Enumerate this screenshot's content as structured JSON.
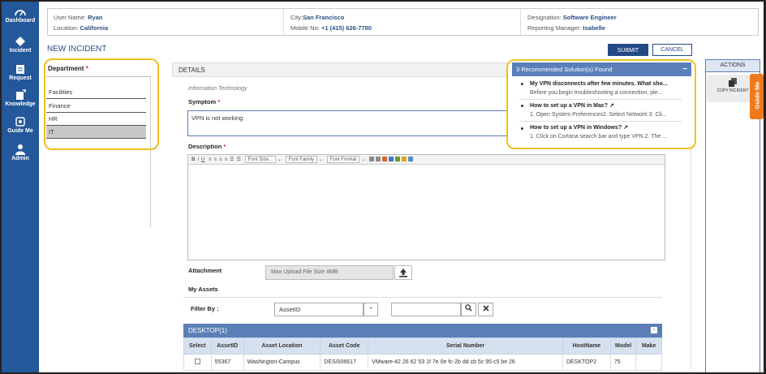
{
  "nav": [
    {
      "label": "Dashboard",
      "icon": "dashboard-icon"
    },
    {
      "label": "Incident",
      "icon": "diamond-icon"
    },
    {
      "label": "Request",
      "icon": "request-icon"
    },
    {
      "label": "Knowledge",
      "icon": "knowledge-icon"
    },
    {
      "label": "Guide Me",
      "icon": "guide-icon"
    },
    {
      "label": "Admin",
      "icon": "admin-icon"
    }
  ],
  "header": {
    "user_name_label": "User Name:",
    "user_name": "Ryan",
    "location_label": "Location:",
    "location": "California",
    "city_label": "City:",
    "city": "San Francisco",
    "mobile_label": "Mobile No:",
    "mobile": "+1 (415) 626-7780",
    "designation_label": "Designation:",
    "designation": "Software Engineer",
    "manager_label": "Reporting Manager:",
    "manager": "Isabelle"
  },
  "page_title": "NEW INCIDENT",
  "buttons": {
    "submit": "SUBMIT",
    "cancel": "CANCEL"
  },
  "department": {
    "label": "Department",
    "required": "*",
    "items": [
      "Facilities",
      "Finance",
      "HR",
      "IT"
    ],
    "selected": "IT"
  },
  "details": {
    "heading": "DETAILS",
    "category": "Information Technology",
    "symptom_label": "Symptom",
    "symptom_value": "VPN is not working",
    "description_label": "Description",
    "toolbar": {
      "font_size": "Font Size...",
      "font_family": "Font Family",
      "font_format": "Font Format"
    },
    "attachment_label": "Attachment",
    "upload_placeholder": "Max Upload File Size 4MB",
    "my_assets_label": "My Assets",
    "filter_label": "Filter By :",
    "filter_value": "AssetID",
    "filter_arrow": "*"
  },
  "desktop": {
    "title": "DESKTOP(1)",
    "columns": [
      "Select",
      "AssetID",
      "Asset Location",
      "Asset Code",
      "Serial Number",
      "HostName",
      "Model",
      "Make"
    ],
    "rows": [
      [
        "",
        "55367",
        "Washington-Campus",
        "DES/006617",
        "VMware-42 26 62 53 1f 7e 0e fc-2b dd cb 5c 95 c5 be 26",
        "DESKTOP2",
        "75",
        ""
      ]
    ]
  },
  "recommendations": {
    "heading": "3 Recommended Solution(s) Found",
    "items": [
      {
        "title": "My VPN disconnects after few minutes. What sho...",
        "desc": "Before you begin troubleshooting a connection, ple..."
      },
      {
        "title": "How to set up a VPN in Mac?",
        "desc": "1. Open System Preferences2. Select Network 3. Cli..."
      },
      {
        "title": "How to set up a VPN in Windows?",
        "desc": "1. Click on Cortana search bar and type VPN.2. The ..."
      }
    ]
  },
  "actions": {
    "heading": "ACTIONS",
    "copy_incident": "COPY INCIDENT"
  },
  "guide_tab": "Guide Me"
}
